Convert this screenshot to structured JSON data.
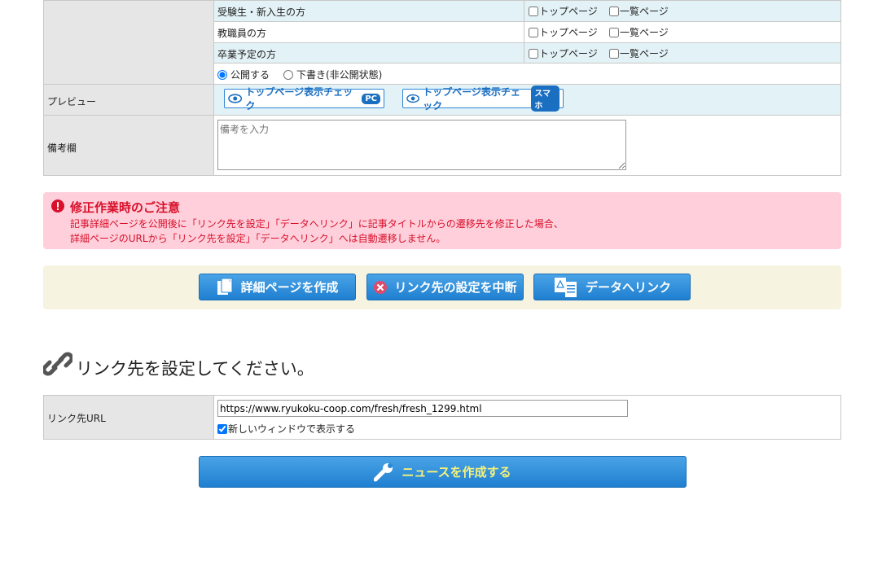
{
  "publish_rows": [
    {
      "label": "受験生・新入生の方",
      "top_page": "トップページ",
      "list_page": "一覧ページ"
    },
    {
      "label": "教職員の方",
      "top_page": "トップページ",
      "list_page": "一覧ページ"
    },
    {
      "label": "卒業予定の方",
      "top_page": "トップページ",
      "list_page": "一覧ページ"
    }
  ],
  "publish_status": {
    "public": "公開する",
    "draft": "下書き(非公開状態)"
  },
  "preview": {
    "label": "プレビュー",
    "pc_button": "トップページ表示チェック",
    "pc_badge": "PC",
    "sp_button": "トップページ表示チェック",
    "sp_badge": "スマホ"
  },
  "remarks": {
    "label": "備考欄",
    "placeholder": "備考を入力"
  },
  "notice": {
    "title": "修正作業時のご注意",
    "line1": "記事詳細ページを公開後に「リンク先を設定」「データへリンク」に記事タイトルからの遷移先を修正した場合、",
    "line2": "詳細ページのURLから「リンク先を設定」「データへリンク」へは自動遷移しません。"
  },
  "actions": {
    "create_detail": "詳細ページを作成",
    "cancel_link": "リンク先の設定を中断",
    "data_link": "データへリンク"
  },
  "link_section": {
    "heading": "リンク先を設定してください。",
    "url_label": "リンク先URL",
    "url_value": "https://www.ryukoku-coop.com/fresh/fresh_1299.html",
    "new_window": "新しいウィンドウで表示する"
  },
  "submit": "ニュースを作成する",
  "colors": {
    "notice_bg": "#ffd0dc",
    "notice_text": "#d8102a",
    "action_bar": "#f7f3e1",
    "button_blue": "#2a8ad8",
    "submit_text": "#f7f27a"
  }
}
